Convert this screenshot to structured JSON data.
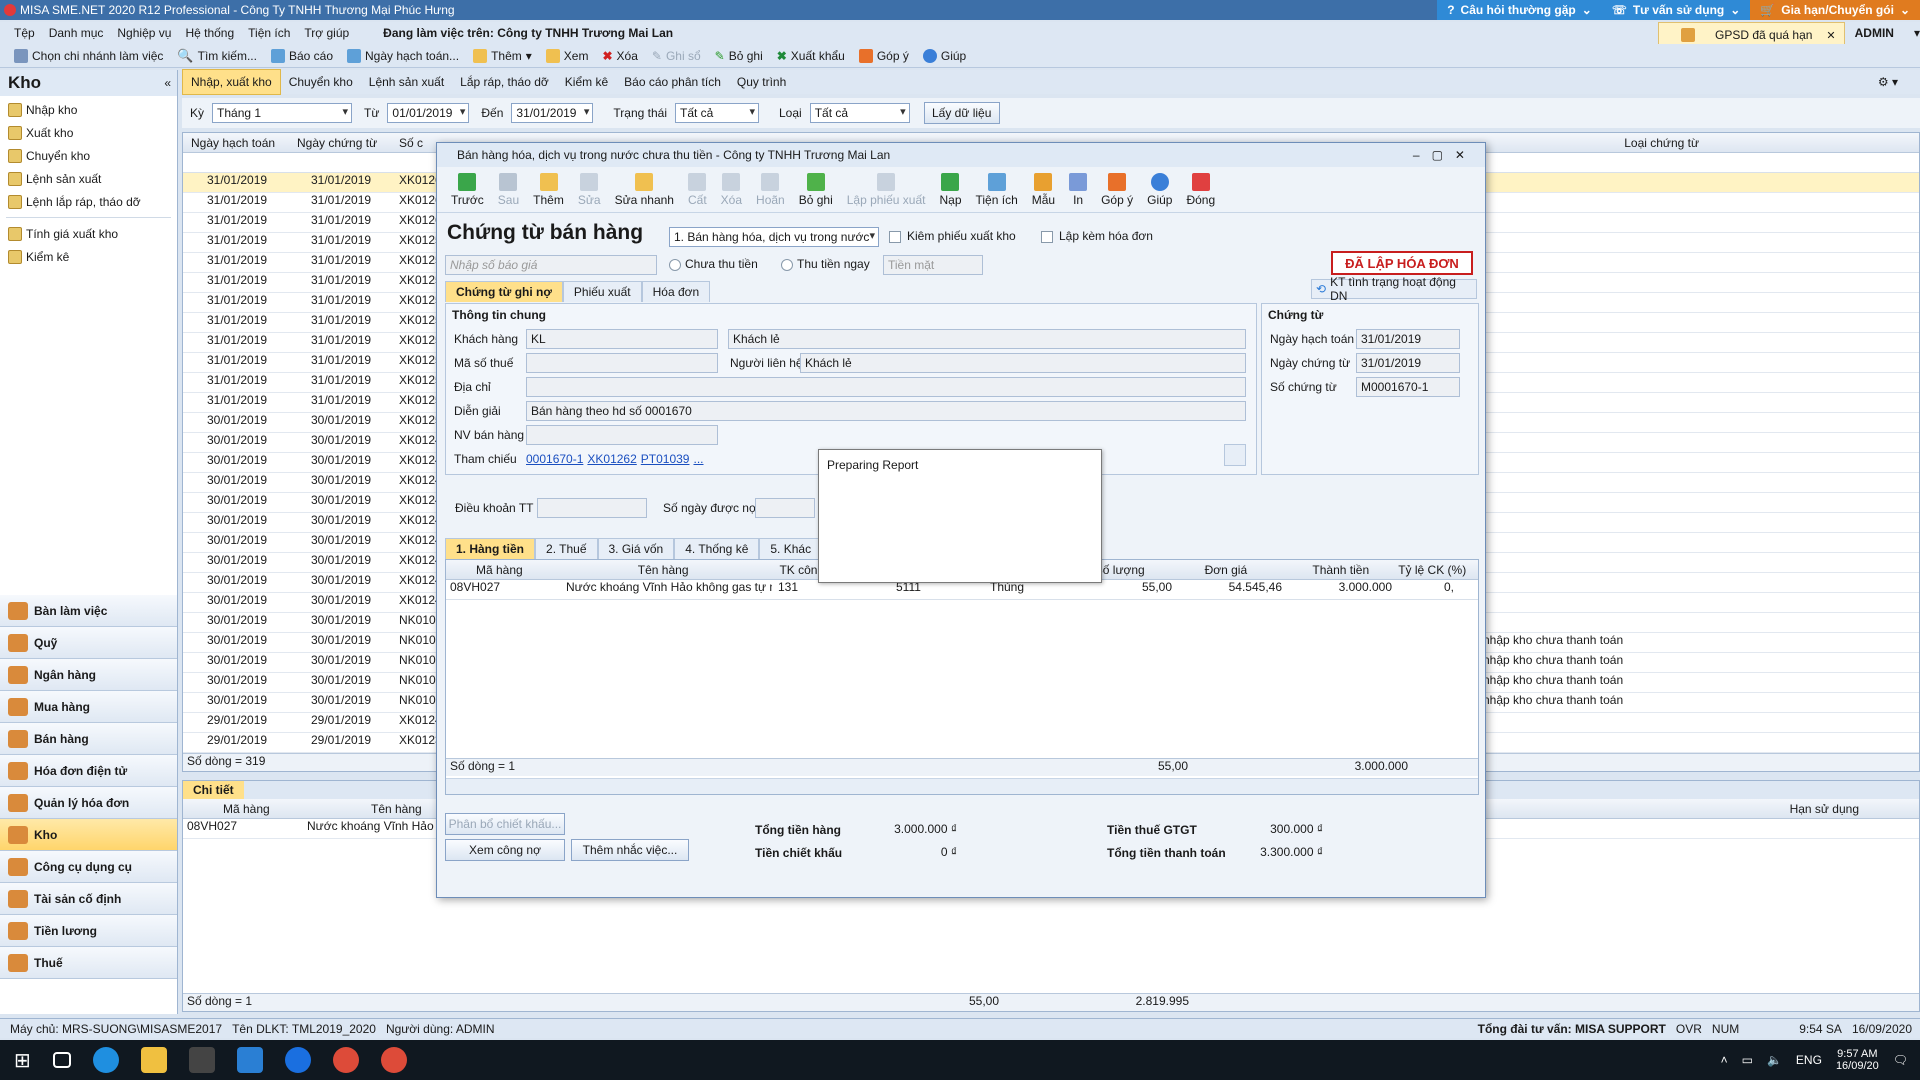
{
  "app": {
    "title": "MISA SME.NET 2020 R12 Professional - Công Ty TNHH Thương Mại Phúc Hưng",
    "help_btn": "Câu hỏi thường gặp",
    "consult_btn": "Tư vấn sử dụng",
    "renew_btn": "Gia hạn/Chuyển gói",
    "gpsd_notice": "GPSD đã quá hạn",
    "user": "ADMIN"
  },
  "menu": {
    "items": [
      "Tệp",
      "Danh mục",
      "Nghiệp vụ",
      "Hệ thống",
      "Tiện ích",
      "Trợ giúp"
    ],
    "working_on": "Đang làm việc trên: Công ty TNHH Trương Mai Lan"
  },
  "toolbar": {
    "items": [
      "Chọn chi nhánh làm việc",
      "Tìm kiếm...",
      "Báo cáo",
      "Ngày hạch toán...",
      "Thêm",
      "Xem",
      "Xóa",
      "Ghi sổ",
      "Bỏ ghi",
      "Xuất khẩu",
      "Góp ý",
      "Giúp"
    ]
  },
  "leftpane": {
    "title": "Kho",
    "collapse": "«",
    "nav": [
      "Nhập kho",
      "Xuất kho",
      "Chuyển kho",
      "Lệnh sản xuất",
      "Lệnh lắp ráp, tháo dỡ",
      "Tính giá xuất kho",
      "Kiểm kê"
    ],
    "modules": [
      "Bàn làm việc",
      "Quỹ",
      "Ngân hàng",
      "Mua hàng",
      "Bán hàng",
      "Hóa đơn điện tử",
      "Quản lý hóa đơn",
      "Kho",
      "Công cụ dụng cụ",
      "Tài sản cố định",
      "Tiền lương",
      "Thuế"
    ]
  },
  "tabs": [
    "Nhập, xuất kho",
    "Chuyển kho",
    "Lệnh sản xuất",
    "Lắp ráp, tháo dỡ",
    "Kiểm kê",
    "Báo cáo phân tích",
    "Quy trình"
  ],
  "filter": {
    "period_label": "Kỳ",
    "period": "Tháng 1",
    "from_label": "Từ",
    "from": "01/01/2019",
    "to_label": "Đến",
    "to": "31/01/2019",
    "status_label": "Trạng thái",
    "status": "Tất cả",
    "type_label": "Loại",
    "type": "Tất cả",
    "fetch_btn": "Lấy dữ liệu"
  },
  "grid": {
    "headers": [
      "Ngày hạch toán",
      "Ngày chứng từ",
      "Số c",
      "Loại chứng từ"
    ],
    "rows": [
      [
        "31/01/2019",
        "31/01/2019",
        "XK0126",
        ""
      ],
      [
        "31/01/2019",
        "31/01/2019",
        "XK0126",
        ""
      ],
      [
        "31/01/2019",
        "31/01/2019",
        "XK0126",
        ""
      ],
      [
        "31/01/2019",
        "31/01/2019",
        "XK0125",
        ""
      ],
      [
        "31/01/2019",
        "31/01/2019",
        "XK0125",
        ""
      ],
      [
        "31/01/2019",
        "31/01/2019",
        "XK0125",
        ""
      ],
      [
        "31/01/2019",
        "31/01/2019",
        "XK0125",
        ""
      ],
      [
        "31/01/2019",
        "31/01/2019",
        "XK0125",
        ""
      ],
      [
        "31/01/2019",
        "31/01/2019",
        "XK0125",
        ""
      ],
      [
        "31/01/2019",
        "31/01/2019",
        "XK0125",
        ""
      ],
      [
        "31/01/2019",
        "31/01/2019",
        "XK0125",
        ""
      ],
      [
        "31/01/2019",
        "31/01/2019",
        "XK0125",
        ""
      ],
      [
        "30/01/2019",
        "30/01/2019",
        "XK0125",
        ""
      ],
      [
        "30/01/2019",
        "30/01/2019",
        "XK0124",
        ""
      ],
      [
        "30/01/2019",
        "30/01/2019",
        "XK0124",
        ""
      ],
      [
        "30/01/2019",
        "30/01/2019",
        "XK0124",
        ""
      ],
      [
        "30/01/2019",
        "30/01/2019",
        "XK0124",
        ""
      ],
      [
        "30/01/2019",
        "30/01/2019",
        "XK0124",
        ""
      ],
      [
        "30/01/2019",
        "30/01/2019",
        "XK0124",
        ""
      ],
      [
        "30/01/2019",
        "30/01/2019",
        "XK0124",
        ""
      ],
      [
        "30/01/2019",
        "30/01/2019",
        "XK0124",
        ""
      ],
      [
        "30/01/2019",
        "30/01/2019",
        "XK0124",
        ""
      ],
      [
        "30/01/2019",
        "30/01/2019",
        "NK0105",
        ""
      ],
      [
        "30/01/2019",
        "30/01/2019",
        "NK0105",
        "nhập kho chưa thanh toán"
      ],
      [
        "30/01/2019",
        "30/01/2019",
        "NK0105",
        "nhập kho chưa thanh toán"
      ],
      [
        "30/01/2019",
        "30/01/2019",
        "NK0105",
        "nhập kho chưa thanh toán"
      ],
      [
        "30/01/2019",
        "30/01/2019",
        "NK0105",
        "nhập kho chưa thanh toán"
      ],
      [
        "29/01/2019",
        "29/01/2019",
        "XK0124",
        ""
      ],
      [
        "29/01/2019",
        "29/01/2019",
        "XK0123",
        ""
      ]
    ],
    "row_count": "Số dòng = 319"
  },
  "detail": {
    "tab": "Chi tiết",
    "headers": [
      "Mã hàng",
      "Tên hàng",
      "Hạn sử dụng"
    ],
    "row": [
      "08VH027",
      "Nước khoáng Vĩnh Hảo kh"
    ],
    "row_count": "Số dòng = 1",
    "total_qty": "55,00",
    "total_value": "2.819.995"
  },
  "dialog": {
    "title": "Bán hàng hóa, dịch vụ trong nước chưa thu tiền - Công ty TNHH Trương Mai Lan",
    "tools": [
      "Trước",
      "Sau",
      "Thêm",
      "Sửa",
      "Sửa nhanh",
      "Cất",
      "Xóa",
      "Hoãn",
      "Bỏ ghi",
      "Lập phiếu xuất",
      "Nạp",
      "Tiện ích",
      "Mẫu",
      "In",
      "Góp ý",
      "Giúp",
      "Đóng"
    ],
    "heading": "Chứng từ bán hàng",
    "type": "1. Bán hàng hóa, dịch vụ trong nước",
    "chk_export": "Kiêm phiếu xuất kho",
    "chk_invoice": "Lập kèm hóa đơn",
    "search_placeholder": "Nhập số báo giá",
    "radio_unpaid": "Chưa thu tiền",
    "radio_paid": "Thu tiền ngay",
    "cash": "Tiền mặt",
    "stamp": "ĐÃ LẬP HÓA ĐƠN",
    "kt_status": "KT tình trạng hoạt động DN",
    "subtabs": [
      "Chứng từ ghi nợ",
      "Phiếu xuất",
      "Hóa đơn"
    ],
    "general": {
      "title": "Thông tin chung",
      "customer_label": "Khách hàng",
      "customer_code": "KL",
      "customer_name": "Khách lẻ",
      "tax_label": "Mã số thuế",
      "contact_label": "Người liên hệ",
      "contact": "Khách lẻ",
      "address_label": "Địa chỉ",
      "desc_label": "Diễn giải",
      "desc": "Bán hàng theo hd số 0001670",
      "seller_label": "NV bán hàng",
      "ref_label": "Tham chiếu",
      "refs": [
        "0001670-1",
        "XK01262",
        "PT01039",
        "..."
      ]
    },
    "voucher": {
      "title": "Chứng từ",
      "post_date_label": "Ngày hạch toán",
      "post_date": "31/01/2019",
      "doc_date_label": "Ngày chứng từ",
      "doc_date": "31/01/2019",
      "doc_no_label": "Số chứng từ",
      "doc_no": "M0001670-1"
    },
    "terms_label": "Điều khoản TT",
    "days_label": "Số ngày được nợ",
    "itabs": [
      "1. Hàng tiền",
      "2. Thuế",
      "3. Giá vốn",
      "4. Thống kê",
      "5. Khác"
    ],
    "items_headers": [
      "Mã hàng",
      "Tên hàng",
      "TK côn",
      "",
      "",
      "Số lượng",
      "Đơn giá",
      "Thành tiền",
      "Tỷ lệ CK (%)"
    ],
    "item_row": [
      "08VH027",
      "Nước khoáng Vĩnh Hảo không gas tự nh",
      "131",
      "5111",
      "Thùng",
      "55,00",
      "54.545,46",
      "3.000.000",
      "0,"
    ],
    "items_count": "Số dòng = 1",
    "items_total_qty": "55,00",
    "items_total_amount": "3.000.000",
    "btn_discount": "Phân bổ chiết khấu...",
    "btn_debt": "Xem công nợ",
    "btn_reminder": "Thêm nhắc việc...",
    "total_goods_label": "Tổng tiền hàng",
    "total_goods": "3.000.000 ₫",
    "discount_label": "Tiền chiết khấu",
    "discount": "0 ₫",
    "vat_label": "Tiền thuế GTGT",
    "vat": "300.000 ₫",
    "grand_label": "Tổng tiền thanh toán",
    "grand": "3.300.000 ₫"
  },
  "popup": {
    "text": "Preparing Report"
  },
  "status": {
    "server": "Máy chủ: MRS-SUONG\\MISASME2017",
    "db": "Tên DLKT: TML2019_2020",
    "user": "Người dùng: ADMIN",
    "support": "Tổng đài tư vấn: MISA SUPPORT",
    "ovr": "OVR",
    "num": "NUM",
    "time": "9:54 SA",
    "date": "16/09/2020"
  },
  "taskbar": {
    "time": "9:57 AM",
    "date": "16/09/20",
    "lang": "ENG"
  },
  "colors": {
    "titlebar": "#3d6fa8",
    "accent_orange": "#e07b1f",
    "active_tab": "#ffe08a",
    "stamp_red": "#c81e1e"
  }
}
